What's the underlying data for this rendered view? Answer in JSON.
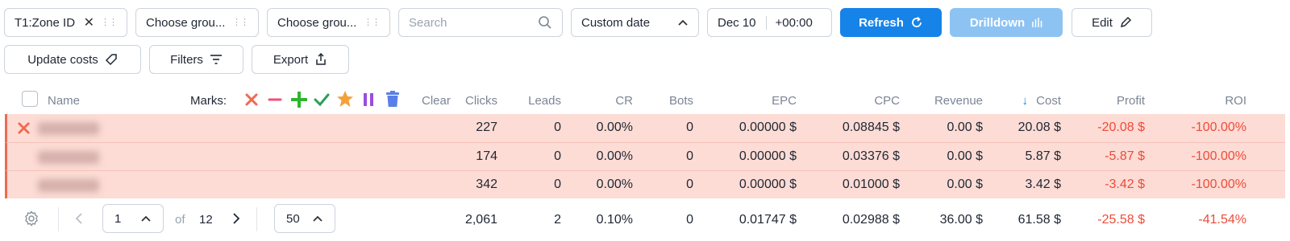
{
  "toolbar": {
    "group1": "T1:Zone ID",
    "group2": "Choose grou...",
    "group3": "Choose grou...",
    "search_placeholder": "Search",
    "date_range": "Custom date",
    "date": "Dec 10",
    "timezone": "+00:00",
    "refresh": "Refresh",
    "drilldown": "Drilldown",
    "edit": "Edit",
    "update_costs": "Update costs",
    "filters": "Filters",
    "export": "Export"
  },
  "table": {
    "headers": {
      "name": "Name",
      "marks": "Marks:",
      "clear": "Clear",
      "clicks": "Clicks",
      "leads": "Leads",
      "cr": "CR",
      "bots": "Bots",
      "epc": "EPC",
      "cpc": "CPC",
      "revenue": "Revenue",
      "cost": "Cost",
      "profit": "Profit",
      "roi": "ROI"
    },
    "rows": [
      {
        "clicks": "227",
        "leads": "0",
        "cr": "0.00%",
        "bots": "0",
        "epc": "0.00000 $",
        "cpc": "0.08845 $",
        "revenue": "0.00 $",
        "cost": "20.08 $",
        "profit": "-20.08 $",
        "roi": "-100.00%"
      },
      {
        "clicks": "174",
        "leads": "0",
        "cr": "0.00%",
        "bots": "0",
        "epc": "0.00000 $",
        "cpc": "0.03376 $",
        "revenue": "0.00 $",
        "cost": "5.87 $",
        "profit": "-5.87 $",
        "roi": "-100.00%"
      },
      {
        "clicks": "342",
        "leads": "0",
        "cr": "0.00%",
        "bots": "0",
        "epc": "0.00000 $",
        "cpc": "0.01000 $",
        "revenue": "0.00 $",
        "cost": "3.42 $",
        "profit": "-3.42 $",
        "roi": "-100.00%"
      }
    ],
    "totals": {
      "clicks": "2,061",
      "leads": "2",
      "cr": "0.10%",
      "bots": "0",
      "epc": "0.01747 $",
      "cpc": "0.02988 $",
      "revenue": "36.00 $",
      "cost": "61.58 $",
      "profit": "-25.58 $",
      "roi": "-41.54%"
    }
  },
  "pager": {
    "page": "1",
    "of_label": "of",
    "total_pages": "12",
    "per_page": "50"
  },
  "colors": {
    "primary": "#1683e8",
    "row_bg": "#fcdcd5",
    "negative": "#ee4b3b",
    "mark_x": "#f06a50"
  }
}
